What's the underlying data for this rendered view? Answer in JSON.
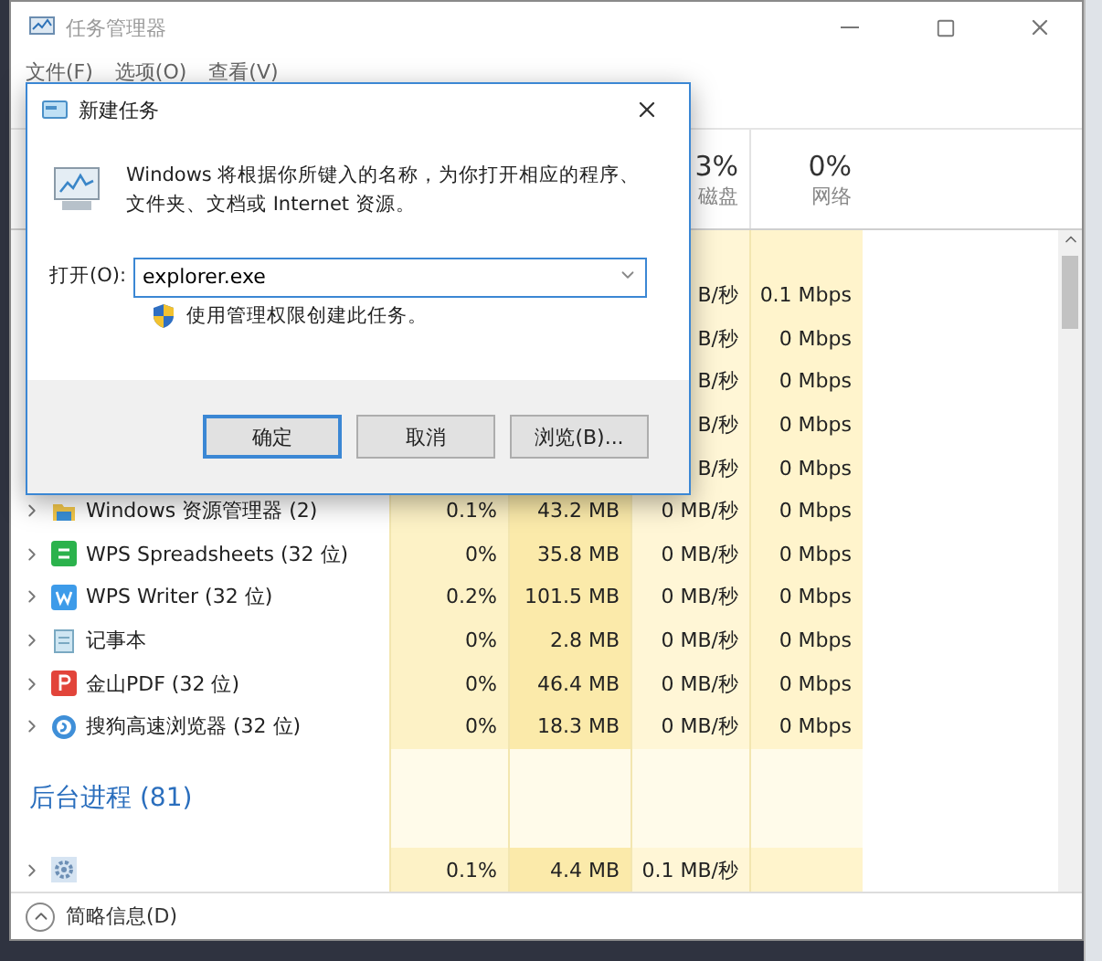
{
  "window": {
    "title": "任务管理器"
  },
  "menu": [
    "文件(F)",
    "选项(O)",
    "查看(V)"
  ],
  "columns": [
    {
      "percent": "3%",
      "label": "磁盘"
    },
    {
      "percent": "0%",
      "label": "网络"
    }
  ],
  "covered_rows": [
    {
      "disk": "B/秒",
      "network": "0.1 Mbps"
    },
    {
      "disk": "B/秒",
      "network": "0 Mbps"
    },
    {
      "disk": "B/秒",
      "network": "0 Mbps"
    },
    {
      "disk": "B/秒",
      "network": "0 Mbps"
    },
    {
      "disk": "B/秒",
      "network": "0 Mbps"
    }
  ],
  "apps": [
    {
      "kind": "folder",
      "name": "Windows 资源管理器 (2)",
      "cpu": "0.1%",
      "memory": "43.2 MB",
      "disk": "0 MB/秒",
      "network": "0 Mbps"
    },
    {
      "kind": "sheet",
      "name": "WPS Spreadsheets (32 位)",
      "cpu": "0%",
      "memory": "35.8 MB",
      "disk": "0 MB/秒",
      "network": "0 Mbps"
    },
    {
      "kind": "writer",
      "name": "WPS Writer (32 位)",
      "cpu": "0.2%",
      "memory": "101.5 MB",
      "disk": "0 MB/秒",
      "network": "0 Mbps"
    },
    {
      "kind": "notepad",
      "name": "记事本",
      "cpu": "0%",
      "memory": "2.8 MB",
      "disk": "0 MB/秒",
      "network": "0 Mbps"
    },
    {
      "kind": "pdf",
      "name": "金山PDF (32 位)",
      "cpu": "0%",
      "memory": "46.4 MB",
      "disk": "0 MB/秒",
      "network": "0 Mbps"
    },
    {
      "kind": "browser",
      "name": "搜狗高速浏览器 (32 位)",
      "cpu": "0%",
      "memory": "18.3 MB",
      "disk": "0 MB/秒",
      "network": "0 Mbps"
    }
  ],
  "background": {
    "title": "后台进程 (81)",
    "rows": [
      {
        "kind": "gear",
        "cpu": "0.1%",
        "memory": "4.4 MB",
        "disk": "0.1 MB/秒"
      }
    ]
  },
  "dialog": {
    "title": "新建任务",
    "message": "Windows 将根据你所键入的名称，为你打开相应的程序、文件夹、文档或 Internet 资源。",
    "open_label": "打开(O):",
    "value": "explorer.exe",
    "admin_note": "使用管理权限创建此任务。",
    "buttons": [
      {
        "label": "确定",
        "focused": true
      },
      {
        "label": "取消",
        "focused": false
      },
      {
        "label": "浏览(B)...",
        "focused": false
      }
    ]
  },
  "footer": {
    "label": "简略信息(D)"
  }
}
